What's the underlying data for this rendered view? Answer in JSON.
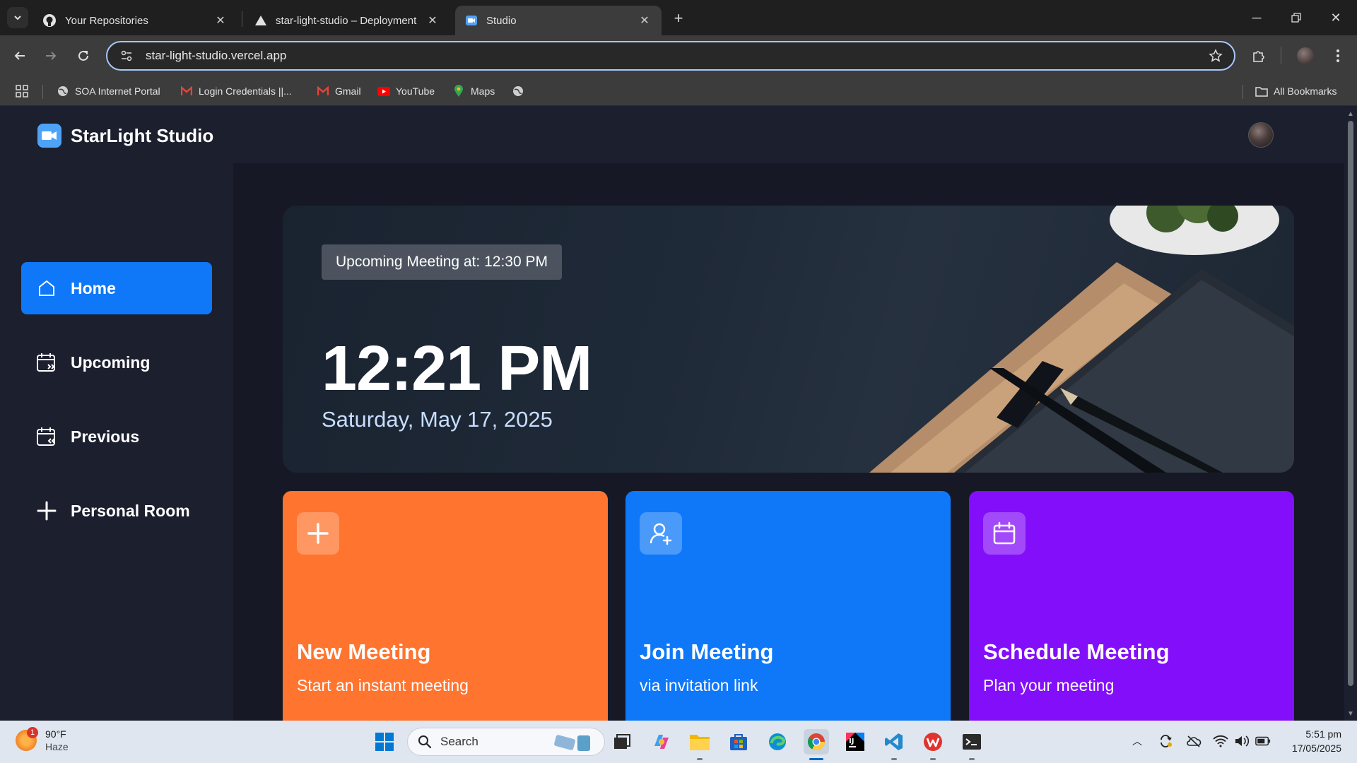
{
  "browser": {
    "tabs": [
      {
        "title": "Your Repositories",
        "icon": "github-icon",
        "active": false
      },
      {
        "title": "star-light-studio – Deployment",
        "icon": "vercel-icon",
        "active": false
      },
      {
        "title": "Studio",
        "icon": "video-camera-icon",
        "active": true
      }
    ],
    "url": "star-light-studio.vercel.app",
    "bookmarks": [
      {
        "label": "SOA Internet Portal",
        "icon": "globe-icon"
      },
      {
        "label": "Login Credentials ||...",
        "icon": "gmail-icon"
      },
      {
        "label": "Gmail",
        "icon": "gmail-icon"
      },
      {
        "label": "YouTube",
        "icon": "youtube-icon"
      },
      {
        "label": "Maps",
        "icon": "maps-pin-icon"
      }
    ],
    "all_bookmarks_label": "All Bookmarks"
  },
  "app": {
    "brand": "StarLight Studio",
    "sidebar": [
      {
        "label": "Home",
        "icon": "home-icon",
        "active": true
      },
      {
        "label": "Upcoming",
        "icon": "calendar-forward-icon",
        "active": false
      },
      {
        "label": "Previous",
        "icon": "calendar-back-icon",
        "active": false
      },
      {
        "label": "Personal Room",
        "icon": "plus-icon",
        "active": false
      }
    ],
    "hero": {
      "upcoming_badge": "Upcoming Meeting at: 12:30 PM",
      "time": "12:21 PM",
      "date": "Saturday, May 17, 2025"
    },
    "cards": [
      {
        "title": "New Meeting",
        "subtitle": "Start an instant meeting",
        "icon": "plus-icon",
        "color": "#ff742e"
      },
      {
        "title": "Join Meeting",
        "subtitle": "via invitation link",
        "icon": "user-add-icon",
        "color": "#0e78f9"
      },
      {
        "title": "Schedule Meeting",
        "subtitle": "Plan your meeting",
        "icon": "calendar-icon",
        "color": "#830ef9"
      }
    ],
    "colors": {
      "accent": "#0e78f9",
      "background": "#1c1f2e",
      "panel": "#161925"
    }
  },
  "taskbar": {
    "weather_temp": "90°F",
    "weather_desc": "Haze",
    "weather_badge": "1",
    "search_placeholder": "Search",
    "time": "5:51 pm",
    "date": "17/05/2025"
  }
}
